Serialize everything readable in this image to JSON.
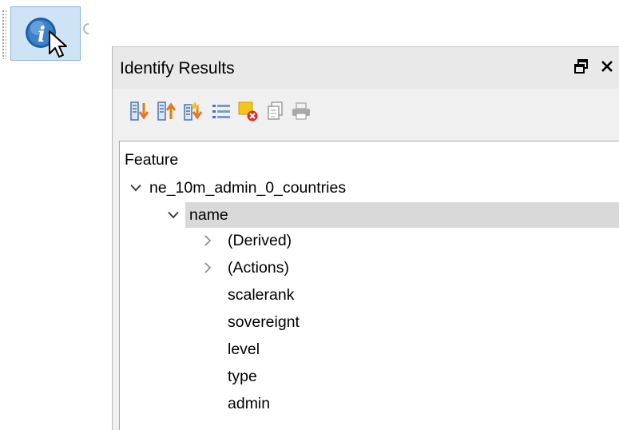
{
  "tool": {
    "icon": "identify-features-icon",
    "cursor_icon": "mouse-pointer-icon"
  },
  "panel": {
    "title": "Identify Results",
    "float_icon": "float-window-icon",
    "close_icon": "close-icon"
  },
  "toolbar": {
    "icons": [
      "expand-tree-icon",
      "collapse-tree-icon",
      "expand-new-results-icon",
      "clear-results-icon",
      "clear-highlights-icon",
      "copy-feature-icon",
      "print-icon"
    ]
  },
  "tree": {
    "header": "Feature",
    "layer": {
      "label": "ne_10m_admin_0_countries",
      "expanded": true
    },
    "feature": {
      "label": "name",
      "expanded": true,
      "selected": true
    },
    "groups": [
      {
        "label": "(Derived)",
        "expanded": false
      },
      {
        "label": "(Actions)",
        "expanded": false
      }
    ],
    "attributes": [
      {
        "label": "scalerank"
      },
      {
        "label": "sovereignt"
      },
      {
        "label": "level"
      },
      {
        "label": "type"
      },
      {
        "label": "admin"
      }
    ]
  },
  "colors": {
    "selection": "#d9d9d9",
    "tool_active_bg": "#cfe3f6",
    "tool_active_border": "#8ab4de"
  }
}
